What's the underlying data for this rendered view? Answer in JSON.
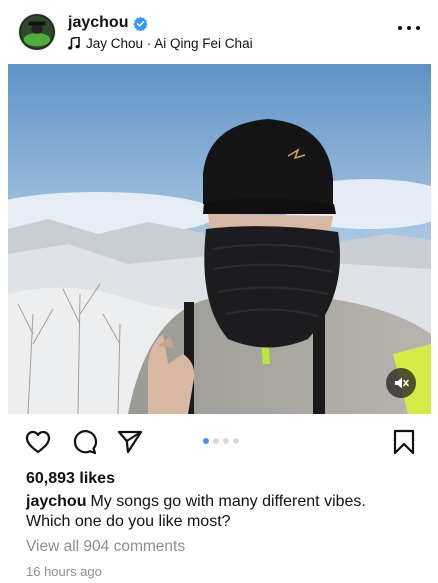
{
  "post": {
    "username": "jaychou",
    "verified": true,
    "music": "Jay Chou · Ai Qing Fei Chai",
    "likes": "60,893 likes",
    "caption": "My songs go with many different vibes. Which one do you like most?",
    "comments_link": "View all 904 comments",
    "timestamp": "16 hours ago",
    "carousel": {
      "count": 4,
      "active_index": 0
    }
  },
  "icons": {
    "avatar": "profile-avatar",
    "verified": "verified-badge-icon",
    "music": "music-note-icon",
    "more": "more-options-icon",
    "mute": "muted-speaker-icon",
    "like": "heart-icon",
    "comment": "comment-bubble-icon",
    "share": "paper-plane-icon",
    "save": "bookmark-icon"
  },
  "colors": {
    "verified_blue": "#3897f0",
    "carousel_active": "#3897f0",
    "muted_text": "#8e8e8e"
  }
}
